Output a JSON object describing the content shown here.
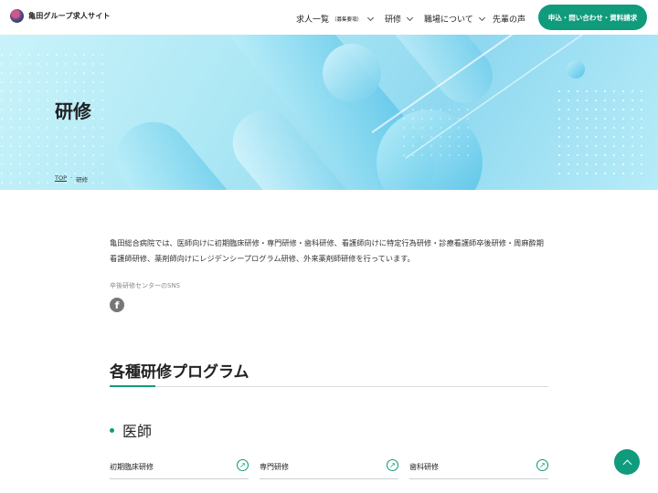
{
  "header": {
    "site_name": "亀田グループ求人サイト",
    "nav": [
      {
        "label": "求人一覧",
        "sub": "（募集要項）"
      },
      {
        "label": "研修"
      },
      {
        "label": "職場について"
      },
      {
        "label": "先輩の声"
      }
    ],
    "cta_label": "申込・問い合わせ・資料請求"
  },
  "hero": {
    "title": "研修",
    "breadcrumb": [
      "TOP",
      "研修"
    ]
  },
  "main": {
    "intro": "亀田総合病院では、医師向けに初期臨床研修・専門研修・歯科研修、看護師向けに特定行為研修・診療看護師卒後研修・周麻酔期看護師研修、薬剤師向けにレジデンシープログラム研修、外来薬剤師研修を行っています。",
    "sns_label": "卒後研修センターのSNS",
    "section_title": "各種研修プログラム",
    "subsection_title": "医師",
    "programs": [
      "初期臨床研修",
      "専門研修",
      "歯科研修"
    ]
  },
  "colors": {
    "accent": "#0f9b7c",
    "hero_light": "#c9f3fa",
    "hero_mid": "#8fd8f0"
  },
  "icons": {
    "facebook": "facebook-icon",
    "program_link": "arrow-up-right-icon",
    "page_top": "chevron-up-icon"
  }
}
